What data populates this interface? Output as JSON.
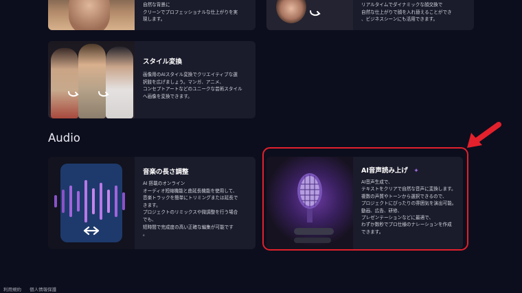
{
  "cards": {
    "top_left": {
      "desc": [
        "自然な背景に",
        "クリーンでプロフェッショナルな仕上がりを実",
        "現します。"
      ]
    },
    "top_right": {
      "desc": [
        "リアルタイムでダイナミックな顔交換で",
        "自然な仕上がりで顔を入れ替えることができ",
        "、ビジネスシーンにも活用できます。"
      ]
    },
    "style": {
      "title": "スタイル変換",
      "desc": [
        "画像用のAIスタイル変換でクリエイティブな選",
        "択肢を広げましょう。マンガ、アニメ、",
        "コンセプトアートなどのユニークな芸術スタイル",
        "へ画像を変換できます。"
      ]
    },
    "music": {
      "title": "音楽の長さ調整",
      "desc": [
        "AI 搭載のオンライン",
        "オーディオ短縮機能と曲延長機能を使用して、",
        "音楽トラックを簡単にトリミングまたは延長で",
        "きます。",
        "プロジェクトのリミックスや微調整を行う場合",
        "でも、",
        "短時間で完成度の高い正確な編集が可能です",
        "。"
      ]
    },
    "voice": {
      "title": "AI音声読み上げ",
      "sparkle": "✦",
      "desc": [
        "AI音声生成で、",
        "テキストをクリアで自然な音声に変換します。",
        "複数の声質やトーンから選択できるので、",
        "プロジェクトにぴったりの雰囲気を演出可能。",
        "動画、広告、研修、",
        "プレゼンテーションなどに最適で、",
        "わずか数秒でプロ仕様のナレーションを作成",
        "できます。"
      ]
    }
  },
  "section": {
    "audio": "Audio"
  },
  "footer": {
    "terms": "利用規約",
    "privacy": "個人情報保護"
  },
  "colors": {
    "background": "#0d0e1d",
    "card": "#1a1b2b",
    "highlight": "#e3212c",
    "accent": "#8e5bd6"
  }
}
